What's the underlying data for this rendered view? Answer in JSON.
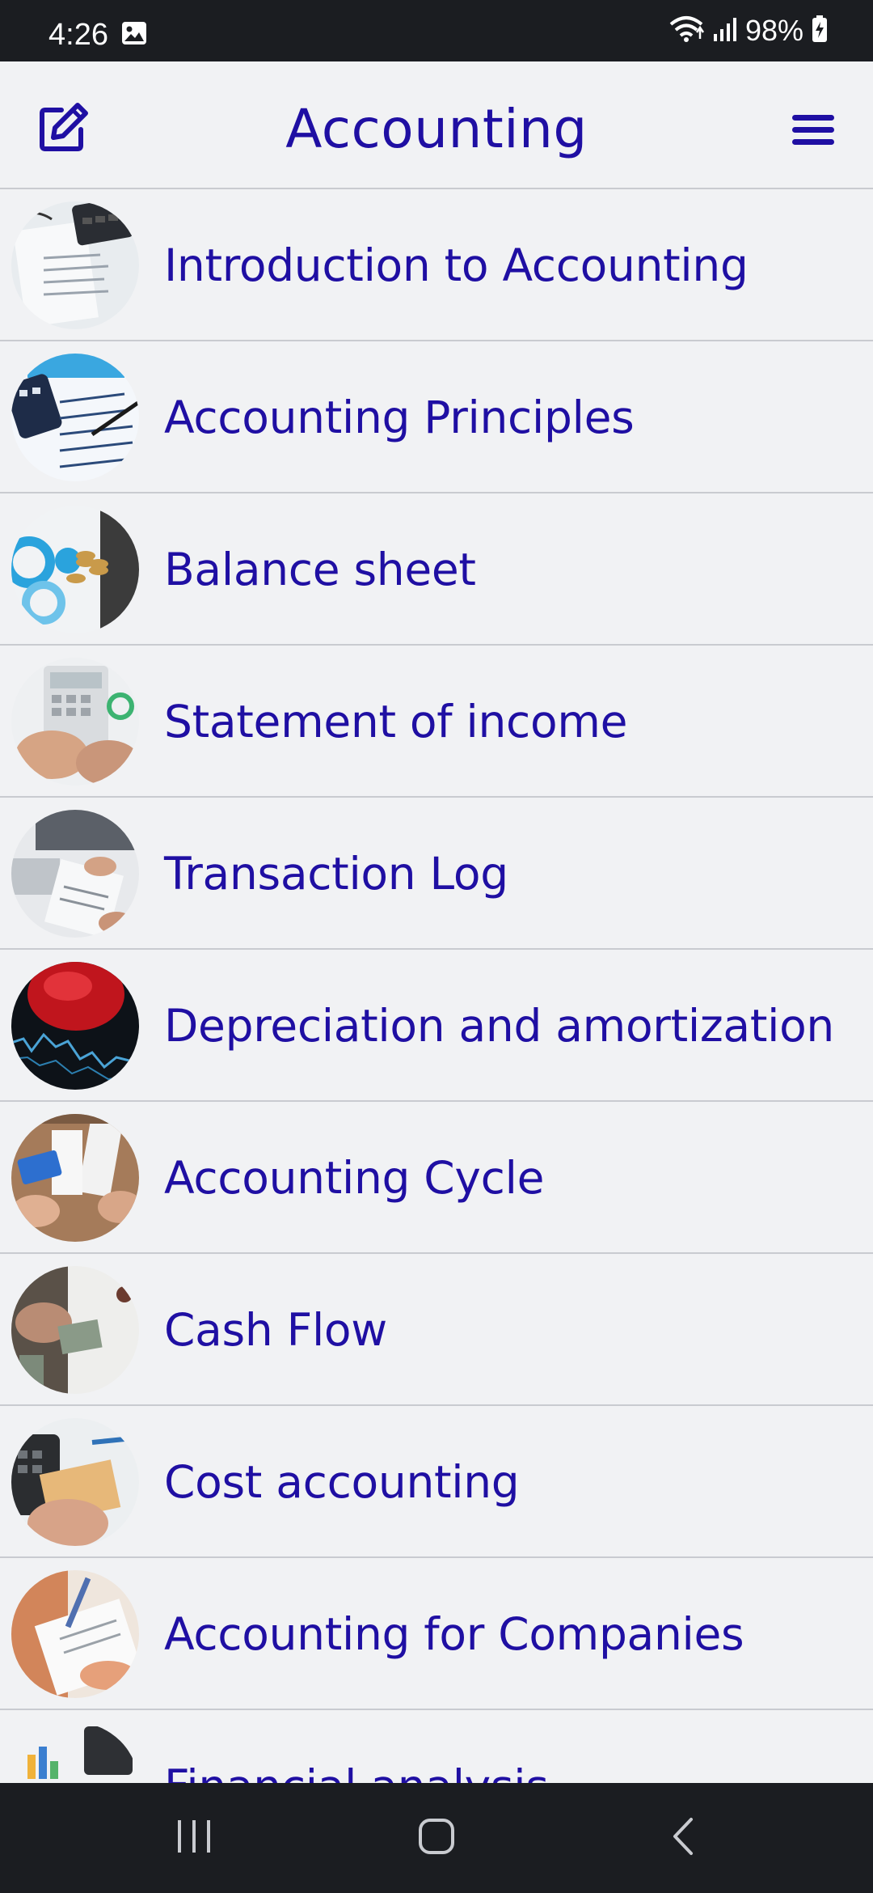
{
  "status_bar": {
    "time": "4:26",
    "battery": "98%",
    "icons": [
      "gallery-icon",
      "wifi-icon",
      "signal-icon",
      "battery-charging-icon"
    ]
  },
  "header": {
    "title": "Accounting",
    "edit_icon": "edit-icon",
    "menu_icon": "hamburger-menu-icon",
    "accent_color": "#1f0fa3"
  },
  "topics": [
    {
      "label": "Introduction to Accounting"
    },
    {
      "label": "Accounting Principles"
    },
    {
      "label": "Balance sheet"
    },
    {
      "label": "Statement of income"
    },
    {
      "label": "Transaction Log"
    },
    {
      "label": "Depreciation and amortization"
    },
    {
      "label": "Accounting Cycle"
    },
    {
      "label": "Cash Flow"
    },
    {
      "label": "Cost accounting"
    },
    {
      "label": "Accounting for Companies"
    },
    {
      "label": "Financial analysis"
    }
  ],
  "nav_bar": {
    "icons": [
      "recent-apps-icon",
      "home-icon",
      "back-icon"
    ]
  }
}
